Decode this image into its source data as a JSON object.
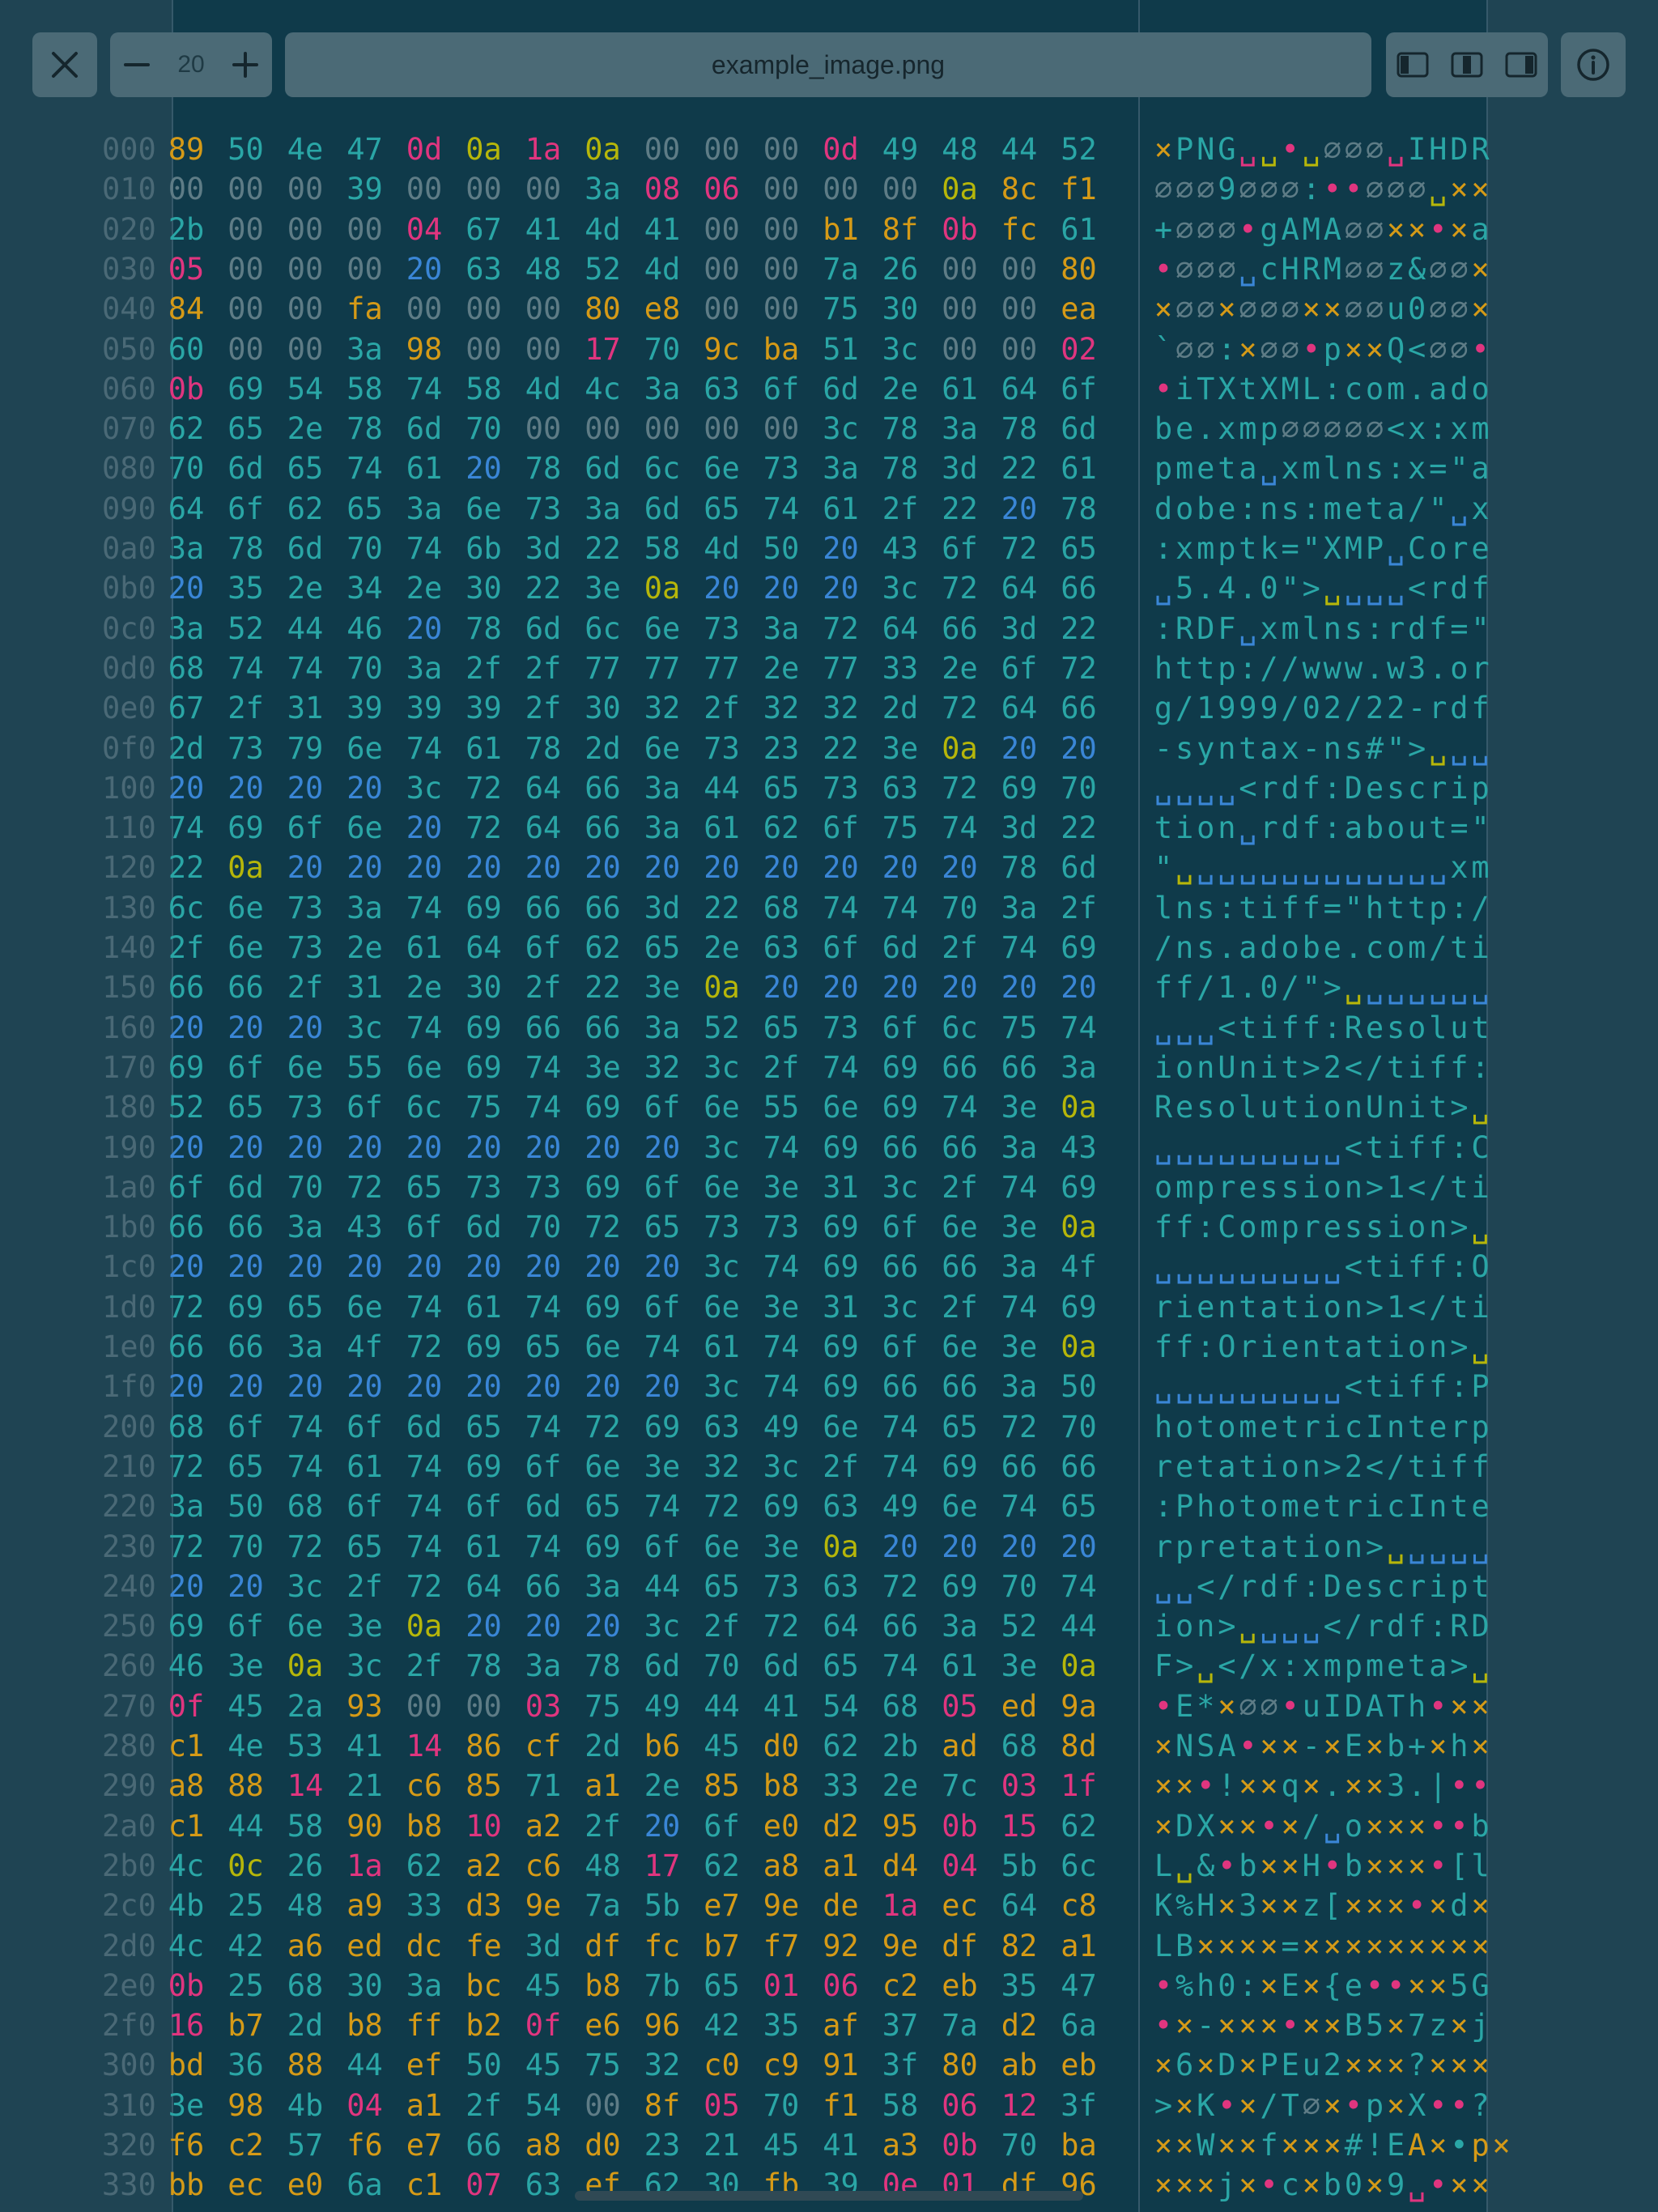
{
  "toolbar": {
    "close_icon": "close-icon",
    "zoom_value": "20",
    "zoom_minus_icon": "minus-icon",
    "zoom_plus_icon": "plus-icon",
    "filename": "example_image.png",
    "layout_icons": [
      "left-panel-icon",
      "split-panel-icon",
      "right-panel-icon"
    ],
    "info_icon": "info-icon"
  },
  "colors": {
    "background": "#1f4453",
    "hex_column_bg": "#0f3a4a",
    "offset": "#4a6976",
    "zero": "#5e7c86",
    "teal": "#2aa6a6",
    "blue": "#3a86d6",
    "yellow": "#b6b60a",
    "orange": "#d59a17",
    "pink": "#e0357f"
  },
  "hexdump": {
    "rows": [
      [
        "000",
        "89 50 4e 47 0d 0a 1a 0a 00 00 00 0d 49 48 44 52",
        "×PNG␣␣•␣∅∅∅␣IHDR"
      ],
      [
        "010",
        "00 00 00 39 00 00 00 3a 08 06 00 00 00 0a 8c f1",
        "∅∅∅9∅∅∅:••∅∅∅␣××"
      ],
      [
        "020",
        "2b 00 00 00 04 67 41 4d 41 00 00 b1 8f 0b fc 61",
        "+∅∅∅•gAMA∅∅××•×a"
      ],
      [
        "030",
        "05 00 00 00 20 63 48 52 4d 00 00 7a 26 00 00 80",
        "•∅∅∅␣cHRM∅∅z&∅∅×"
      ],
      [
        "040",
        "84 00 00 fa 00 00 00 80 e8 00 00 75 30 00 00 ea",
        "×∅∅×∅∅∅××∅∅u0∅∅×"
      ],
      [
        "050",
        "60 00 00 3a 98 00 00 17 70 9c ba 51 3c 00 00 02",
        "`∅∅:×∅∅•p××Q<∅∅•"
      ],
      [
        "060",
        "0b 69 54 58 74 58 4d 4c 3a 63 6f 6d 2e 61 64 6f",
        "•iTXtXML:com.ado"
      ],
      [
        "070",
        "62 65 2e 78 6d 70 00 00 00 00 00 3c 78 3a 78 6d",
        "be.xmp∅∅∅∅∅<x:xm"
      ],
      [
        "080",
        "70 6d 65 74 61 20 78 6d 6c 6e 73 3a 78 3d 22 61",
        "pmeta␣xmlns:x=\"a"
      ],
      [
        "090",
        "64 6f 62 65 3a 6e 73 3a 6d 65 74 61 2f 22 20 78",
        "dobe:ns:meta/\"␣x"
      ],
      [
        "0a0",
        "3a 78 6d 70 74 6b 3d 22 58 4d 50 20 43 6f 72 65",
        ":xmptk=\"XMP␣Core"
      ],
      [
        "0b0",
        "20 35 2e 34 2e 30 22 3e 0a 20 20 20 3c 72 64 66",
        "␣5.4.0\">␣␣␣␣<rdf"
      ],
      [
        "0c0",
        "3a 52 44 46 20 78 6d 6c 6e 73 3a 72 64 66 3d 22",
        ":RDF␣xmlns:rdf=\""
      ],
      [
        "0d0",
        "68 74 74 70 3a 2f 2f 77 77 77 2e 77 33 2e 6f 72",
        "http://www.w3.or"
      ],
      [
        "0e0",
        "67 2f 31 39 39 39 2f 30 32 2f 32 32 2d 72 64 66",
        "g/1999/02/22-rdf"
      ],
      [
        "0f0",
        "2d 73 79 6e 74 61 78 2d 6e 73 23 22 3e 0a 20 20",
        "-syntax-ns#\">␣␣␣"
      ],
      [
        "100",
        "20 20 20 20 3c 72 64 66 3a 44 65 73 63 72 69 70",
        "␣␣␣␣<rdf:Descrip"
      ],
      [
        "110",
        "74 69 6f 6e 20 72 64 66 3a 61 62 6f 75 74 3d 22",
        "tion␣rdf:about=\""
      ],
      [
        "120",
        "22 0a 20 20 20 20 20 20 20 20 20 20 20 20 78 6d",
        "\"␣␣␣␣␣␣␣␣␣␣␣␣␣xm"
      ],
      [
        "130",
        "6c 6e 73 3a 74 69 66 66 3d 22 68 74 74 70 3a 2f",
        "lns:tiff=\"http:/"
      ],
      [
        "140",
        "2f 6e 73 2e 61 64 6f 62 65 2e 63 6f 6d 2f 74 69",
        "/ns.adobe.com/ti"
      ],
      [
        "150",
        "66 66 2f 31 2e 30 2f 22 3e 0a 20 20 20 20 20 20",
        "ff/1.0/\">␣␣␣␣␣␣␣"
      ],
      [
        "160",
        "20 20 20 3c 74 69 66 66 3a 52 65 73 6f 6c 75 74",
        "␣␣␣<tiff:Resolut"
      ],
      [
        "170",
        "69 6f 6e 55 6e 69 74 3e 32 3c 2f 74 69 66 66 3a",
        "ionUnit>2</tiff:"
      ],
      [
        "180",
        "52 65 73 6f 6c 75 74 69 6f 6e 55 6e 69 74 3e 0a",
        "ResolutionUnit>␣"
      ],
      [
        "190",
        "20 20 20 20 20 20 20 20 20 3c 74 69 66 66 3a 43",
        "␣␣␣␣␣␣␣␣␣<tiff:C"
      ],
      [
        "1a0",
        "6f 6d 70 72 65 73 73 69 6f 6e 3e 31 3c 2f 74 69",
        "ompression>1</ti"
      ],
      [
        "1b0",
        "66 66 3a 43 6f 6d 70 72 65 73 73 69 6f 6e 3e 0a",
        "ff:Compression>␣"
      ],
      [
        "1c0",
        "20 20 20 20 20 20 20 20 20 3c 74 69 66 66 3a 4f",
        "␣␣␣␣␣␣␣␣␣<tiff:O"
      ],
      [
        "1d0",
        "72 69 65 6e 74 61 74 69 6f 6e 3e 31 3c 2f 74 69",
        "rientation>1</ti"
      ],
      [
        "1e0",
        "66 66 3a 4f 72 69 65 6e 74 61 74 69 6f 6e 3e 0a",
        "ff:Orientation>␣"
      ],
      [
        "1f0",
        "20 20 20 20 20 20 20 20 20 3c 74 69 66 66 3a 50",
        "␣␣␣␣␣␣␣␣␣<tiff:P"
      ],
      [
        "200",
        "68 6f 74 6f 6d 65 74 72 69 63 49 6e 74 65 72 70",
        "hotometricInterp"
      ],
      [
        "210",
        "72 65 74 61 74 69 6f 6e 3e 32 3c 2f 74 69 66 66",
        "retation>2</tiff"
      ],
      [
        "220",
        "3a 50 68 6f 74 6f 6d 65 74 72 69 63 49 6e 74 65",
        ":PhotometricInte"
      ],
      [
        "230",
        "72 70 72 65 74 61 74 69 6f 6e 3e 0a 20 20 20 20",
        "rpretation>␣␣␣␣␣"
      ],
      [
        "240",
        "20 20 3c 2f 72 64 66 3a 44 65 73 63 72 69 70 74",
        "␣␣</rdf:Descript"
      ],
      [
        "250",
        "69 6f 6e 3e 0a 20 20 20 3c 2f 72 64 66 3a 52 44",
        "ion>␣␣␣␣</rdf:RD"
      ],
      [
        "260",
        "46 3e 0a 3c 2f 78 3a 78 6d 70 6d 65 74 61 3e 0a",
        "F>␣</x:xmpmeta>␣"
      ],
      [
        "270",
        "0f 45 2a 93 00 00 03 75 49 44 41 54 68 05 ed 9a",
        "•E*×∅∅•uIDATh•××"
      ],
      [
        "280",
        "c1 4e 53 41 14 86 cf 2d b6 45 d0 62 2b ad 68 8d",
        "×NSA•××-×E×b+×h×"
      ],
      [
        "290",
        "a8 88 14 21 c6 85 71 a1 2e 85 b8 33 2e 7c 03 1f",
        "××•!××q×.××3.|••"
      ],
      [
        "2a0",
        "c1 44 58 90 b8 10 a2 2f 20 6f e0 d2 95 0b 15 62",
        "×DX××•×/␣o×××••b"
      ],
      [
        "2b0",
        "4c 0c 26 1a 62 a2 c6 48 17 62 a8 a1 d4 04 5b 6c",
        "L␣&•b××H•b×××•[l"
      ],
      [
        "2c0",
        "4b 25 48 a9 33 d3 9e 7a 5b e7 9e de 1a ec 64 c8",
        "K%H×3××z[×××•×d×"
      ],
      [
        "2d0",
        "4c 42 a6 ed dc fe 3d df fc b7 f7 92 9e df 82 a1",
        "LB××××=×××××××××"
      ],
      [
        "2e0",
        "0b 25 68 30 3a bc 45 b8 7b 65 01 06 c2 eb 35 47",
        "•%h0:×E×{e••××5G"
      ],
      [
        "2f0",
        "16 b7 2d b8 ff b2 0f e6 96 42 35 af 37 7a d2 6a",
        "•×-×××•××B5×7z×j"
      ],
      [
        "300",
        "bd 36 88 44 ef 50 45 75 32 c0 c9 91 3f 80 ab eb",
        "×6×D×PEu2×××?×××"
      ],
      [
        "310",
        "3e 98 4b 04 a1 2f 54 00 8f 05 70 f1 58 06 12 3f",
        ">×K•×/T∅×•p×X••?"
      ],
      [
        "320",
        "f6 c2 57 f6 e7 66 a8 d0 23 21 45 41 a3 0b 70 ba",
        "××W××f×××#!EA×•p×"
      ],
      [
        "330",
        "bb ec e0 6a c1 07 63 ef 62 30 fb 39 0e 01 df 96",
        "×××j×•c×b0×9␣•××"
      ]
    ]
  }
}
